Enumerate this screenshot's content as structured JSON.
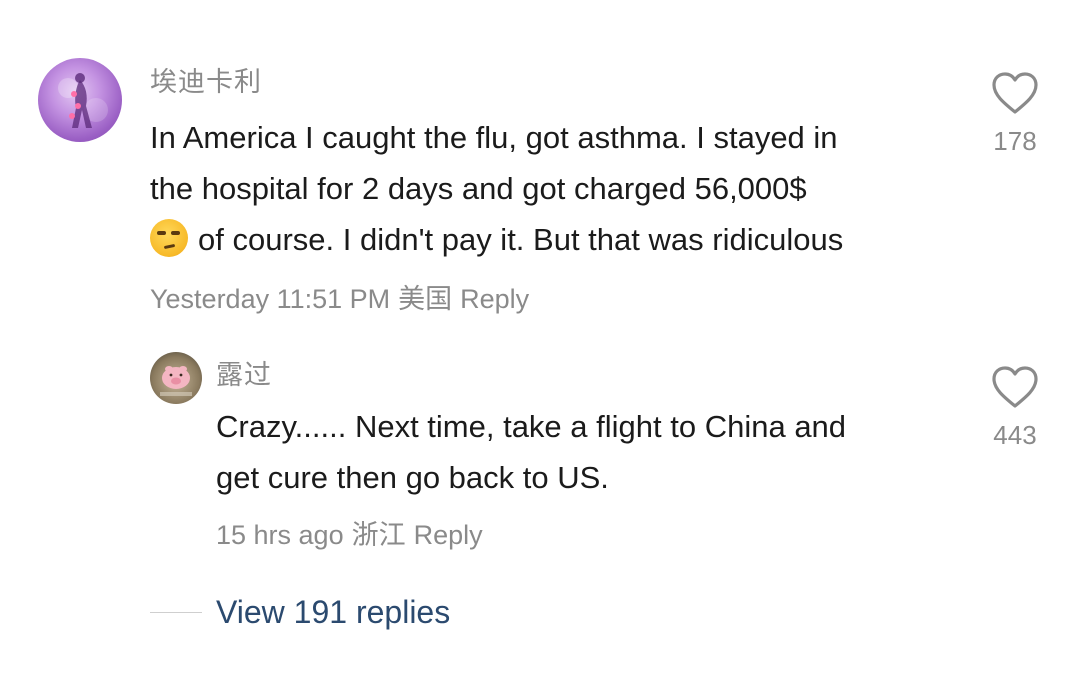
{
  "comment": {
    "username": "埃迪卡利",
    "text_line1": "In America I caught the flu, got asthma. I stayed in",
    "text_line2": "the hospital for 2 days and got charged 56,000$",
    "emoji": "unamused-face-emoji",
    "text_line3": "of course. I didn't pay it. But that was ridiculous",
    "timestamp": "Yesterday 11:51 PM",
    "location": "美国",
    "reply_label": "Reply",
    "like_count": "178"
  },
  "reply": {
    "username": "露过",
    "text_line1": "Crazy...... Next time, take a flight to China and",
    "text_line2": "get cure then go back to US.",
    "timestamp": "15 hrs ago",
    "location": "浙江",
    "reply_label": "Reply",
    "like_count": "443"
  },
  "view_replies_label": "View 191 replies",
  "colors": {
    "secondary_text": "#8a8a8a",
    "primary_text": "#1b1b1b",
    "link": "#2b4a6f"
  }
}
